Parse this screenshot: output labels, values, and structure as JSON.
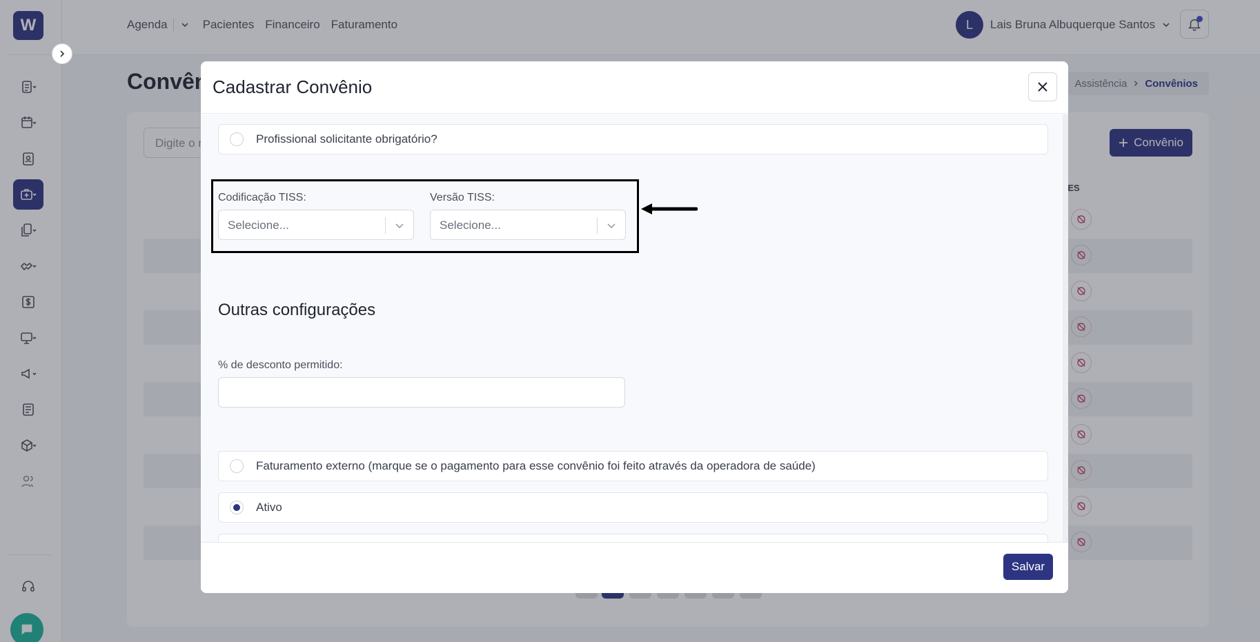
{
  "app": {
    "logo_letter": "W"
  },
  "topbar": {
    "nav": [
      {
        "label": "Agenda"
      },
      {
        "label": "Pacientes"
      },
      {
        "label": "Financeiro"
      },
      {
        "label": "Faturamento"
      }
    ],
    "user_name": "Lais Bruna Albuquerque Santos",
    "user_initial": "L"
  },
  "page": {
    "title": "Convênios",
    "breadcrumb": [
      "Assistência",
      "Convênios"
    ],
    "search_placeholder": "Digite o n",
    "add_button": "Convênio",
    "column_header": "DES"
  },
  "modal": {
    "title": "Cadastrar Convênio",
    "requester_required_label": "Profissional solicitante obrigatório?",
    "tiss_coding": {
      "label": "Codificação TISS:",
      "placeholder": "Selecione..."
    },
    "tiss_version": {
      "label": "Versão TISS:",
      "placeholder": "Selecione..."
    },
    "other_settings_title": "Outras configurações",
    "discount_label": "% de desconto permitido:",
    "discount_value": "",
    "external_billing_label": "Faturamento externo (marque se o pagamento para esse convênio foi feito através da operadora de saúde)",
    "active_label": "Ativo",
    "active_checked": true,
    "save_button": "Salvar"
  },
  "colors": {
    "primary": "#2d3582",
    "accent_green": "#1bb39c",
    "highlight_border": "#000000"
  }
}
